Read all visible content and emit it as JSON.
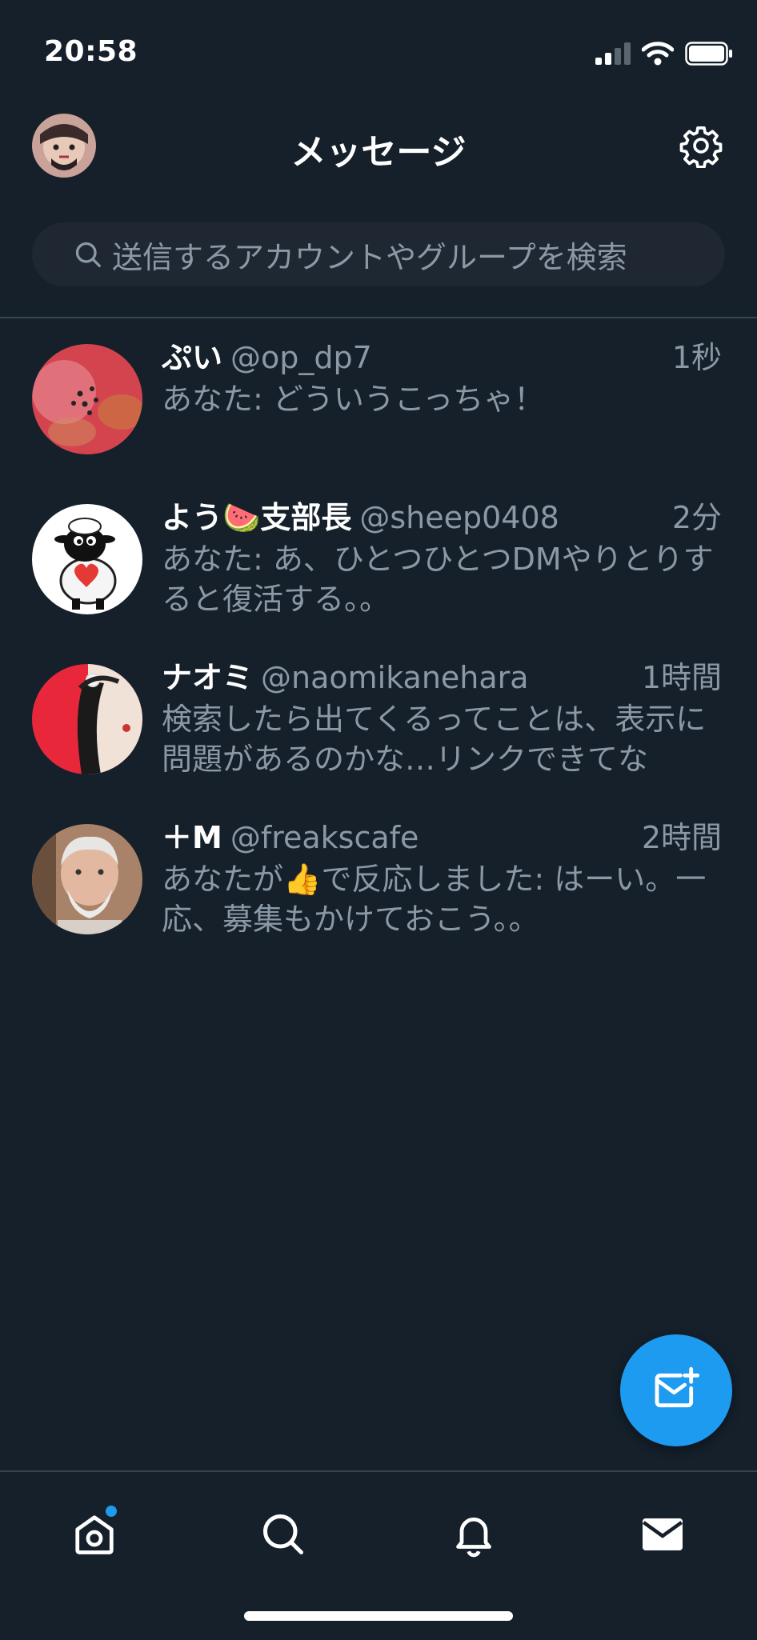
{
  "status_bar": {
    "time": "20:58"
  },
  "header": {
    "title": "メッセージ"
  },
  "search": {
    "placeholder": "送信するアカウントやグループを検索"
  },
  "conversations": [
    {
      "name": "ぷい",
      "handle": "@op_dp7",
      "time": "1秒",
      "preview": "あなた: どういうこっちゃ！"
    },
    {
      "name": "よう🍉支部長",
      "handle": "@sheep0408",
      "time": "2分",
      "preview": "あなた: あ、ひとつひとつDMやりとりすると復活する。。"
    },
    {
      "name": "ナオミ",
      "handle": "@naomikanehara",
      "time": "1時間",
      "preview": "検索したら出てくるってことは、表示に問題があるのかな…リンクできてな"
    },
    {
      "name": "＋M",
      "handle": "@freakscafe",
      "time": "2時間",
      "preview": "あなたが👍で反応しました: はーい。一応、募集もかけておこう。。"
    }
  ],
  "colors": {
    "background": "#15202b",
    "accent": "#1d9bf0",
    "secondary_text": "#8b98a5",
    "divider": "#38444d"
  },
  "icons": [
    "signal-icon",
    "wifi-icon",
    "battery-icon",
    "gear-icon",
    "search-icon",
    "new-message-icon",
    "home-icon",
    "search-tab-icon",
    "bell-icon",
    "mail-icon"
  ]
}
